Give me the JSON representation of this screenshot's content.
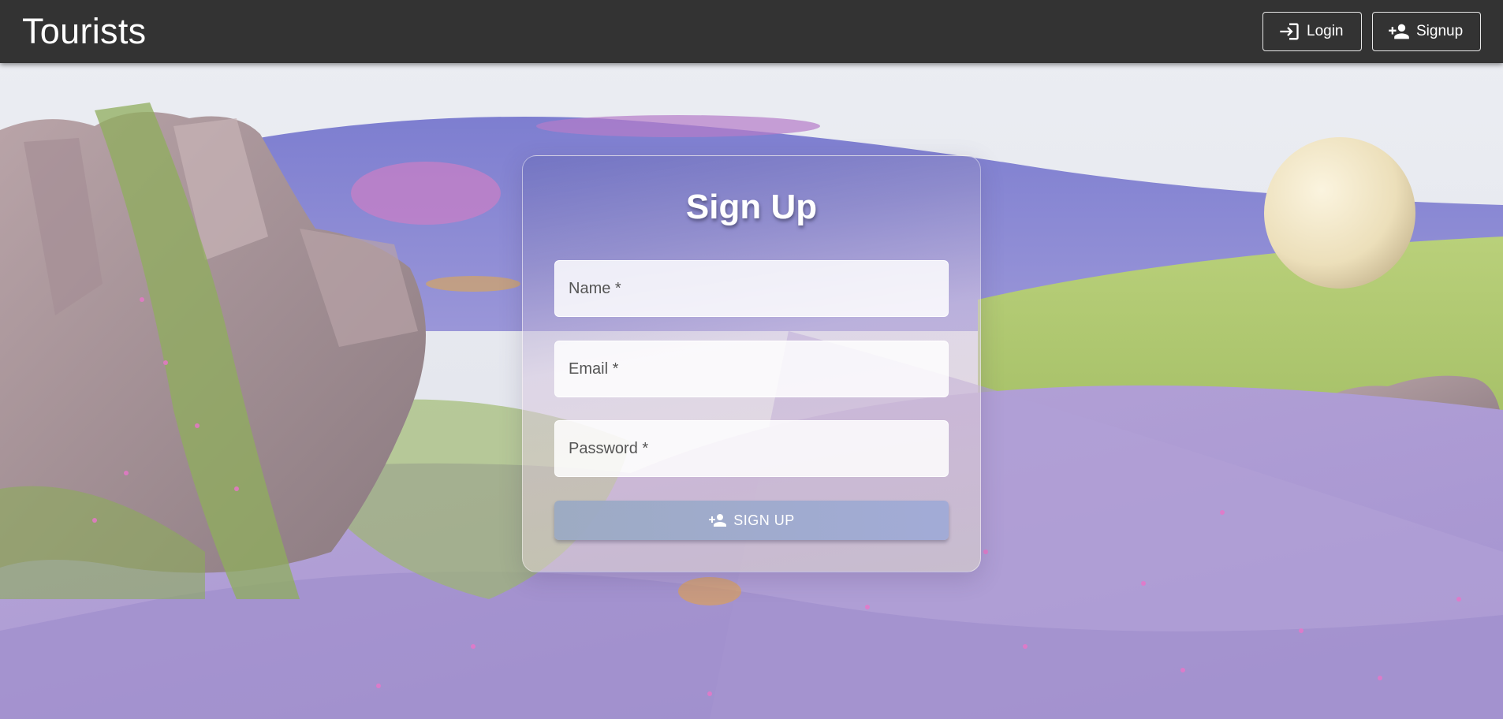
{
  "app": {
    "title": "Tourists"
  },
  "nav": {
    "login_label": "Login",
    "signup_label": "Signup",
    "login_icon": "login-icon",
    "signup_icon": "person-add-icon"
  },
  "form": {
    "title": "Sign Up",
    "name_label": "Name *",
    "email_label": "Email *",
    "password_label": "Password *",
    "submit_label": "SIGN UP",
    "submit_icon": "person-add-icon"
  },
  "colors": {
    "topbar": "#333333",
    "lavender": "#9b8fd0",
    "meadow": "#a6c46a"
  }
}
